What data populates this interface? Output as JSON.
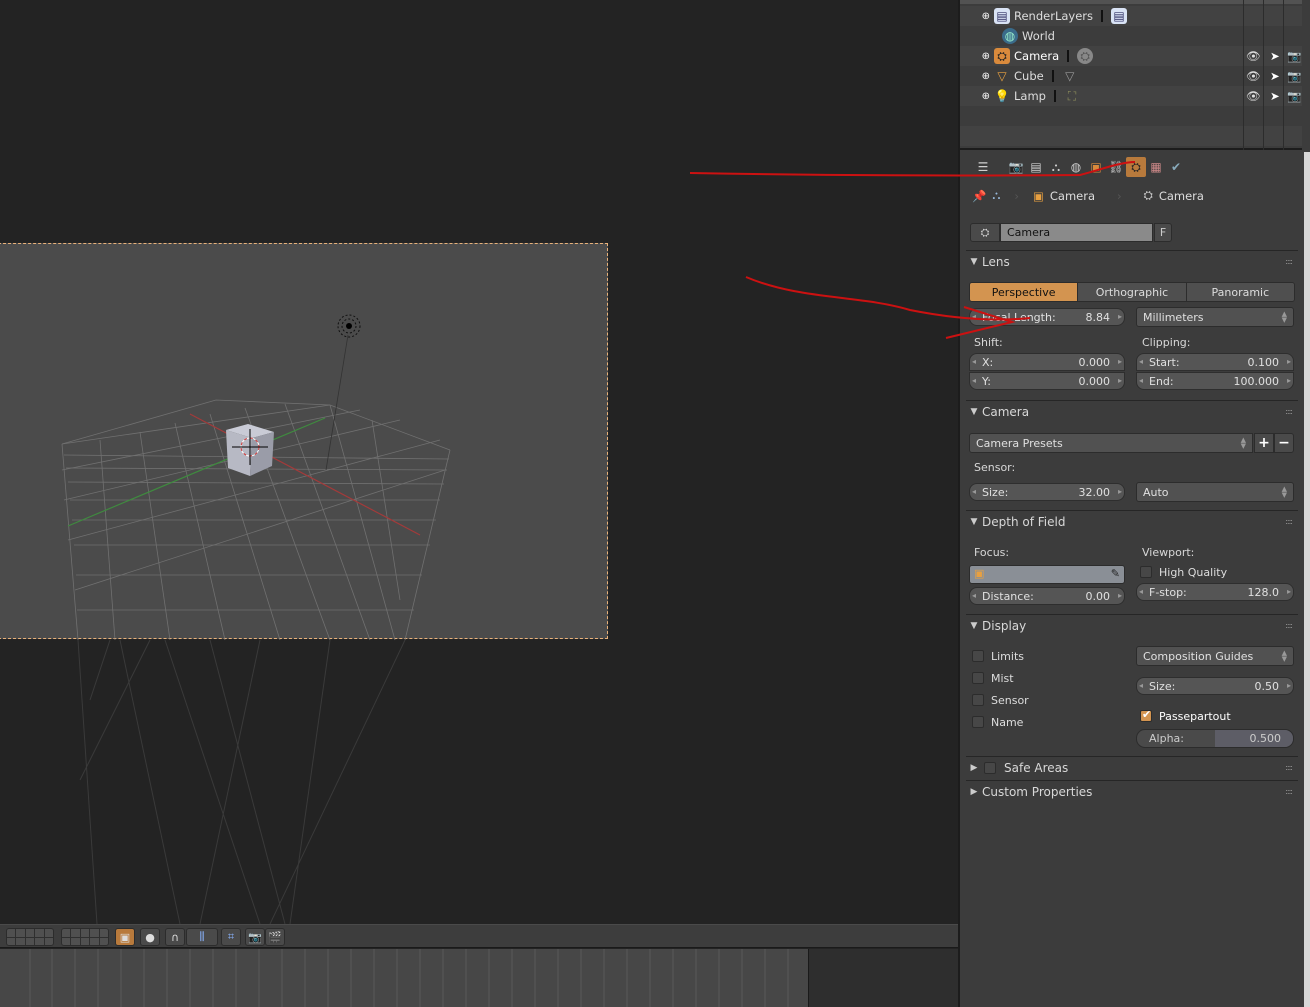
{
  "outliner": {
    "rows": [
      {
        "name": "RenderLayers",
        "icon": "render-layers-icon",
        "has_expand": true,
        "linked_icon": "render-layers-icon"
      },
      {
        "name": "World",
        "icon": "world-icon",
        "has_expand": false
      },
      {
        "name": "Camera",
        "icon": "camera-object-icon",
        "has_expand": true,
        "linked_icon": "camera-data-icon",
        "selected": true
      },
      {
        "name": "Cube",
        "icon": "mesh-icon",
        "has_expand": true,
        "linked_icon": "mesh-data-icon"
      },
      {
        "name": "Lamp",
        "icon": "lamp-icon",
        "has_expand": true,
        "linked_icon": "lamp-data-icon"
      }
    ]
  },
  "properties": {
    "tabs": [
      "render-icon",
      "render-layers-icon",
      "scene-icon",
      "world-icon",
      "object-icon",
      "constraints-icon",
      "camera-data-icon",
      "texture-icon",
      "scene-settings-icon"
    ],
    "active_tab": "camera-data-icon",
    "breadcrumb": [
      "Camera",
      "Camera"
    ],
    "datablock": {
      "name": "Camera",
      "fake_user": "F"
    },
    "lens": {
      "title": "Lens",
      "projection": [
        "Perspective",
        "Orthographic",
        "Panoramic"
      ],
      "active_projection": "Perspective",
      "focal_length": {
        "label": "Focal Length:",
        "value": "8.84"
      },
      "lens_unit": "Millimeters",
      "shift_label": "Shift:",
      "shift_x": {
        "label": "X:",
        "value": "0.000"
      },
      "shift_y": {
        "label": "Y:",
        "value": "0.000"
      },
      "clipping_label": "Clipping:",
      "clip_start": {
        "label": "Start:",
        "value": "0.100"
      },
      "clip_end": {
        "label": "End:",
        "value": "100.000"
      }
    },
    "camera": {
      "title": "Camera",
      "presets": "Camera Presets",
      "add": "+",
      "remove": "−",
      "sensor_label": "Sensor:",
      "sensor_size": {
        "label": "Size:",
        "value": "32.00"
      },
      "sensor_fit": "Auto"
    },
    "dof": {
      "title": "Depth of Field",
      "focus_label": "Focus:",
      "viewport_label": "Viewport:",
      "high_quality": {
        "label": "High Quality",
        "checked": false
      },
      "distance": {
        "label": "Distance:",
        "value": "0.00"
      },
      "fstop": {
        "label": "F-stop:",
        "value": "128.0"
      }
    },
    "display": {
      "title": "Display",
      "checks": [
        {
          "label": "Limits",
          "checked": false
        },
        {
          "label": "Mist",
          "checked": false
        },
        {
          "label": "Sensor",
          "checked": false
        },
        {
          "label": "Name",
          "checked": false
        }
      ],
      "composition_guides": "Composition Guides",
      "size": {
        "label": "Size:",
        "value": "0.50"
      },
      "passepartout": {
        "label": "Passepartout",
        "checked": true
      },
      "alpha": {
        "label": "Alpha:",
        "value": "0.500",
        "fraction": 0.5
      }
    },
    "safe_areas": {
      "title": "Safe Areas",
      "checked": false
    },
    "custom_properties": {
      "title": "Custom Properties"
    }
  },
  "colors": {
    "accent": "#d39450",
    "annotation": "#cc1111"
  }
}
